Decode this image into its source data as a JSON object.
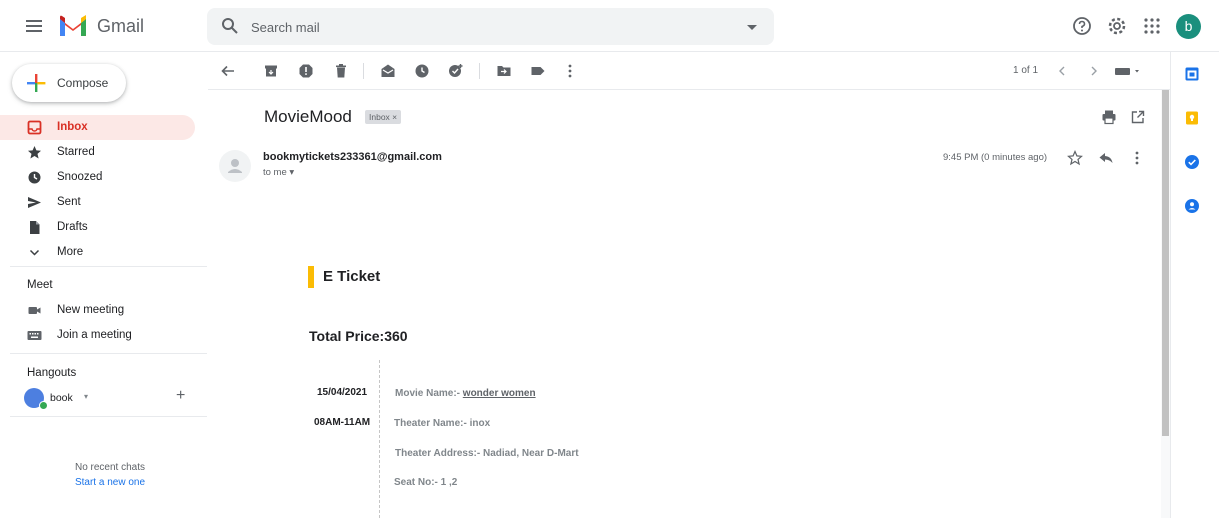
{
  "app": {
    "name": "Gmail"
  },
  "search": {
    "placeholder": "Search mail"
  },
  "sidebar": {
    "compose_label": "Compose",
    "items": [
      {
        "label": "Inbox",
        "icon": "inbox-icon",
        "active": true
      },
      {
        "label": "Starred",
        "icon": "star-icon"
      },
      {
        "label": "Snoozed",
        "icon": "clock-icon"
      },
      {
        "label": "Sent",
        "icon": "send-icon"
      },
      {
        "label": "Drafts",
        "icon": "draft-icon"
      },
      {
        "label": "More",
        "icon": "chevron-down-icon"
      }
    ],
    "meet": {
      "title": "Meet",
      "items": [
        {
          "label": "New meeting",
          "icon": "video-icon"
        },
        {
          "label": "Join a meeting",
          "icon": "keyboard-icon"
        }
      ]
    },
    "hangouts": {
      "title": "Hangouts",
      "user": "book",
      "no_chats": "No recent chats",
      "start_new": "Start a new one"
    }
  },
  "toolbar": {
    "pager": "1 of 1"
  },
  "message": {
    "subject": "MovieMood",
    "label": "Inbox ×",
    "sender": "bookmytickets233361@gmail.com",
    "to": "to me ▾",
    "time": "9:45 PM (0 minutes ago)"
  },
  "ticket": {
    "title": "E Ticket",
    "total": "Total Price:360",
    "date": "15/04/2021",
    "slot": "08AM-11AM",
    "movie_label": "Movie Name:- ",
    "movie_name": "wonder women",
    "theater": "Theater Name:- inox",
    "address": "Theater Address:- Nadiad, Near D-Mart",
    "seat": "Seat No:- 1 ,2"
  },
  "avatar_letter": "b",
  "colors": {
    "accent_red": "#d93025",
    "active_bg": "#fce8e6",
    "ticket_bar": "#fbbc04",
    "link_blue": "#1a73e8",
    "avatar_bg": "#1a8f7d"
  }
}
